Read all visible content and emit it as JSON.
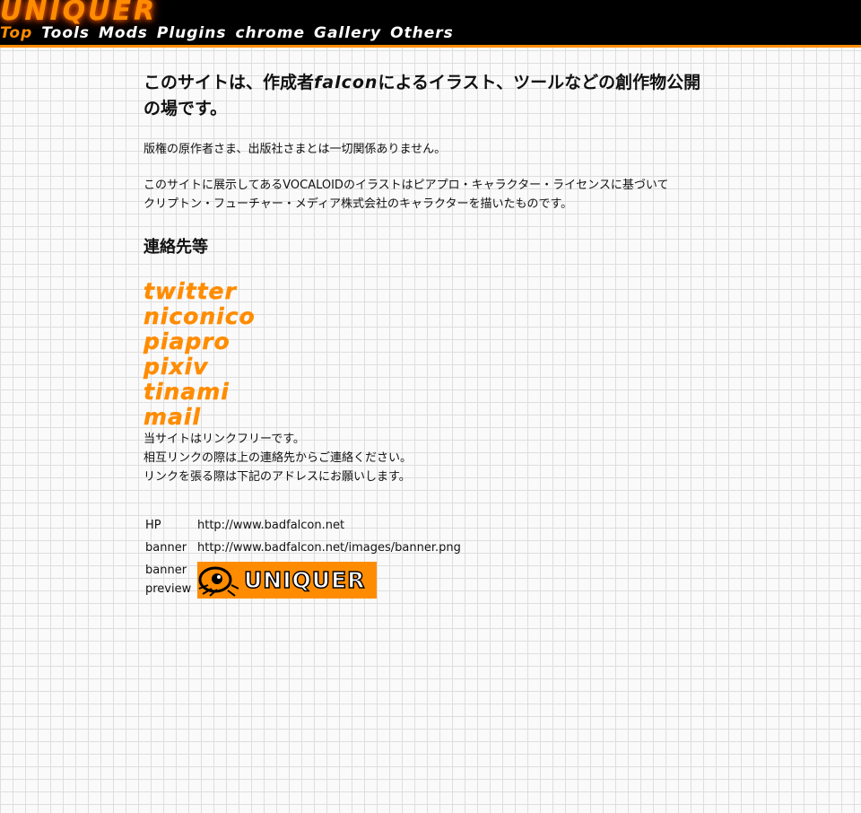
{
  "header": {
    "logo": "UNIQUER",
    "nav": [
      "Top",
      "Tools",
      "Mods",
      "Plugins",
      "chrome",
      "Gallery",
      "Others"
    ],
    "active_nav": "Top"
  },
  "intro": {
    "pre": "このサイトは、作成者",
    "name": "falcon",
    "post": "によるイラスト、ツールなどの創作物公開の場です。"
  },
  "notices": {
    "copyright": "版権の原作者さま、出版社さまとは一切関係ありません。",
    "vocaloid_line1": "このサイトに展示してあるVOCALOIDのイラストはピアプロ・キャラクター・ライセンスに基づいて",
    "vocaloid_line2": "クリプトン・フューチャー・メディア株式会社のキャラクターを描いたものです。"
  },
  "contact": {
    "heading": "連絡先等",
    "links": [
      "twitter",
      "niconico",
      "piapro",
      "pixiv",
      "tinami",
      "mail"
    ]
  },
  "link_policy": {
    "line1": "当サイトはリンクフリーです。",
    "line2": "相互リンクの際は上の連絡先からご連絡ください。",
    "line3": "リンクを張る際は下記のアドレスにお願いします。"
  },
  "info": {
    "hp_label": "HP",
    "hp_url": "http://www.badfalcon.net",
    "banner_label": "banner",
    "banner_url": "http://www.badfalcon.net/images/banner.png",
    "preview_label_1": "banner",
    "preview_label_2": "preview",
    "banner_text": "UNIQUER"
  },
  "colors": {
    "accent": "#ff8c00",
    "header_bg": "#000000",
    "grid_line": "#dedede"
  }
}
